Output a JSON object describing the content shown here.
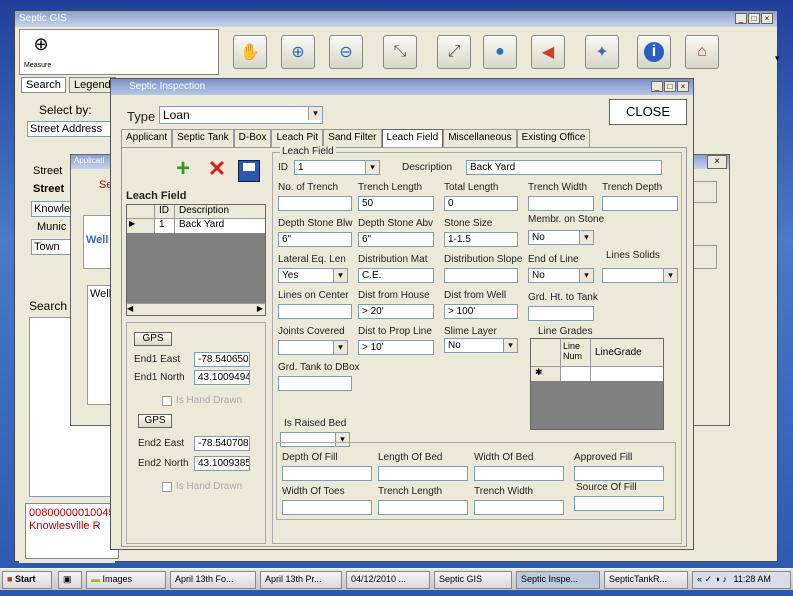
{
  "gis": {
    "title": "Septic GIS",
    "measure_label": "Measure"
  },
  "toolbar_tools": [
    {
      "icon": "pan-hand-icon",
      "glyph": "✋"
    },
    {
      "icon": "zoom-in-icon",
      "glyph": "🔍"
    },
    {
      "icon": "zoom-out-icon",
      "glyph": "🔎"
    },
    {
      "icon": "zoom-extent-in-icon",
      "glyph": "⤡"
    },
    {
      "icon": "zoom-extent-out-icon",
      "glyph": "⤢"
    },
    {
      "icon": "globe-icon",
      "glyph": "🌐"
    },
    {
      "icon": "back-arrow-icon",
      "glyph": "⬅"
    },
    {
      "icon": "satellite-icon",
      "glyph": "🛰"
    },
    {
      "icon": "info-icon",
      "glyph": "ℹ"
    },
    {
      "icon": "home-icon",
      "glyph": "⌂"
    }
  ],
  "left_panel": {
    "tab_search": "Search",
    "tab_legend": "Legend",
    "select_by_label": "Select by:",
    "select_by_value": "Street Address",
    "street_label_1": "Street",
    "street_label_2": "Street",
    "street_value": "Knowle",
    "municipality_label": "Munic",
    "municipality_value": "Town",
    "search_label": "Search",
    "result_line1": "00800000010045",
    "result_line2": "Knowlesville R"
  },
  "back_dialog": {
    "title": "Applicati",
    "partial_text_1": "Se",
    "partial_text_2": "Well",
    "partial_text_3": "Well"
  },
  "septic": {
    "title": "Septic Inspection",
    "type_label": "Type",
    "type_value": "Loan",
    "close_label": "CLOSE",
    "tabs": [
      "Applicant",
      "Septic Tank",
      "D-Box",
      "Leach Pit",
      "Sand Filter",
      "Leach Field",
      "Miscellaneous",
      "Existing Office"
    ],
    "active_tab": "Leach Field",
    "leach_field_label": "Leach Field",
    "grid": {
      "col_id": "ID",
      "col_desc": "Description",
      "row_id": "1",
      "row_desc": "Back Yard"
    },
    "gps_label": "GPS",
    "end1_east_label": "End1 East",
    "end1_east_value": "-78.5406500",
    "end1_north_label": "End1 North",
    "end1_north_value": "43.1009494",
    "end1_hand_drawn": "Is Hand Drawn",
    "end2_east_label": "End2 East",
    "end2_east_value": "-78.5407083",
    "end2_north_label": "End2 North",
    "end2_north_value": "43.1009385",
    "end2_hand_drawn": "Is Hand Drawn",
    "section_title": "Leach Field",
    "fields": {
      "id_label": "ID",
      "id_value": "1",
      "desc_label": "Description",
      "desc_value": "Back Yard",
      "no_trench_label": "No. of Trench",
      "no_trench_value": "",
      "trench_length_label": "Trench Length",
      "trench_length_value": "50",
      "total_length_label": "Total Length",
      "total_length_value": "0",
      "trench_width_label": "Trench Width",
      "trench_width_value": "",
      "trench_depth_label": "Trench Depth",
      "trench_depth_value": "",
      "depth_stone_blw_label": "Depth Stone Blw",
      "depth_stone_blw_value": "6\"",
      "depth_stone_abv_label": "Depth Stone Abv",
      "depth_stone_abv_value": "6\"",
      "stone_size_label": "Stone Size",
      "stone_size_value": "1-1.5",
      "membrane_label": "Membr. on Stone",
      "membrane_value": "No",
      "lateral_eq_label": "Lateral Eq. Len",
      "lateral_eq_value": "Yes",
      "distribution_mat_label": "Distribution Mat",
      "distribution_mat_value": "C.E.",
      "distribution_slope_label": "Distribution Slope",
      "distribution_slope_value": "",
      "end_of_line_label": "End of Line",
      "end_of_line_value": "No",
      "lines_solids_label": "Lines Solids",
      "lines_solids_value": "",
      "lines_on_center_label": "Lines on Center",
      "lines_on_center_value": "",
      "dist_house_label": "Dist from House",
      "dist_house_value": "> 20'",
      "dist_well_label": "Dist from Well",
      "dist_well_value": "> 100'",
      "grd_ht_tank_label": "Grd. Ht. to Tank",
      "grd_ht_tank_value": "",
      "joints_covered_label": "Joints Covered",
      "joints_covered_value": "",
      "dist_prop_line_label": "Dist to Prop Line",
      "dist_prop_line_value": "> 10'",
      "slime_layer_label": "Slime Layer",
      "slime_layer_value": "No",
      "grd_tank_dbox_label": "Grd. Tank to DBox",
      "grd_tank_dbox_value": "",
      "line_grades_label": "Line Grades",
      "line_grades_col1": "Line Num",
      "line_grades_col2": "LineGrade",
      "raised_bed_label": "Is Raised Bed",
      "raised_bed_value": "",
      "depth_fill_label": "Depth Of Fill",
      "length_bed_label": "Length Of Bed",
      "width_bed_label": "Width Of Bed",
      "approved_fill_label": "Approved Fill",
      "width_toes_label": "Width Of Toes",
      "trench_length2_label": "Trench Length",
      "trench_width2_label": "Trench Width",
      "source_fill_label": "Source Of Fill"
    }
  },
  "taskbar": {
    "start": "Start",
    "tasks": [
      "Images",
      "April 13th Fo...",
      "April 13th Pr...",
      "04/12/2010 ...",
      "Septic GIS",
      "Septic Inspe...",
      "SepticTankR..."
    ],
    "time": "11:28 AM"
  }
}
